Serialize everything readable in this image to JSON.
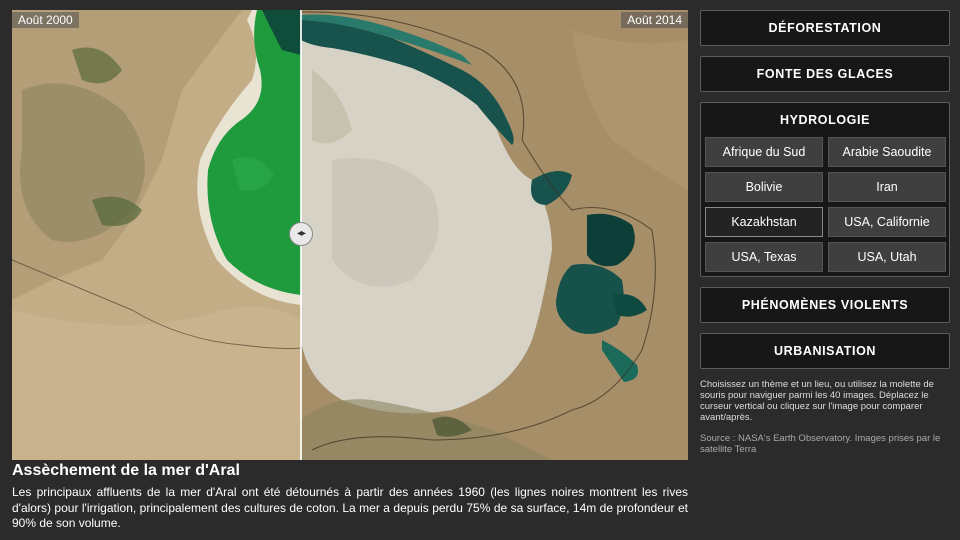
{
  "viewer": {
    "before_label": "Août 2000",
    "after_label": "Août 2014",
    "slider_glyph": "◂▸",
    "slider_icon": "left-right-arrows-icon"
  },
  "caption": {
    "title": "Assèchement de la mer d'Aral",
    "text": "Les principaux affluents de la mer d'Aral ont été détournés à partir des années 1960 (les lignes noires montrent les rives d'alors) pour l'irrigation, principalement des cultures de coton. La mer a depuis perdu 75% de sa surface, 14m de profondeur et 90% de son volume."
  },
  "sidebar": {
    "themes": {
      "deforestation": "DÉFORESTATION",
      "glaciers": "FONTE DES GLACES",
      "hydrology": "HYDROLOGIE",
      "violent": "PHÉNOMÈNES VIOLENTS",
      "urban": "URBANISATION"
    },
    "locations": [
      "Afrique du Sud",
      "Arabie Saoudite",
      "Bolivie",
      "Iran",
      "Kazakhstan",
      "USA, Californie",
      "USA, Texas",
      "USA, Utah"
    ],
    "active_location": "Kazakhstan",
    "help": "Choisissez un thème et un lieu, ou utilisez la molette de souris pour naviguer parmi les 40 images.   Déplacez le curseur vertical ou cliquez sur l'image pour comparer avant/après.",
    "source": "Source : NASA's Earth Observatory. Images prises par le satellite Terra"
  },
  "colors": {
    "page_bg": "#2b2b2b",
    "button_bg": "#171717",
    "location_bg": "#3f3f3f",
    "water_2000": "#1f9a3c",
    "water_2014": "#16524a",
    "desert": "#b9a37f",
    "salt_flat": "#d6d2c6"
  }
}
